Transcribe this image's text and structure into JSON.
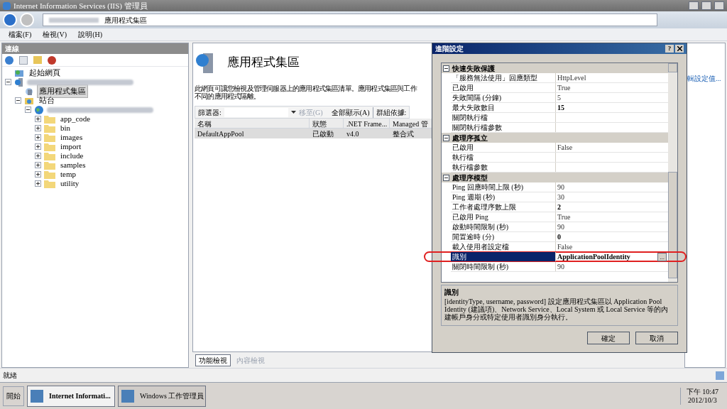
{
  "window": {
    "title": "Internet Information Services (IIS) 管理員"
  },
  "address_bar": {
    "crumbs": [
      {
        "kind": "redacted"
      },
      {
        "kind": "text",
        "label": "應用程式集區"
      }
    ]
  },
  "menu": [
    "檔案(F)",
    "檢視(V)",
    "說明(H)"
  ],
  "connections": {
    "title": "連線",
    "tree": [
      {
        "kind": "home",
        "label": "起始網頁",
        "selected": false
      },
      {
        "kind": "server",
        "expanded": true,
        "selected": false,
        "children": [
          {
            "kind": "pool",
            "label": "應用程式集區",
            "selected": true
          },
          {
            "kind": "sites",
            "label": "站台",
            "expanded": true,
            "selected": false,
            "children": [
              {
                "kind": "site",
                "expanded": true,
                "selected": false,
                "children": [
                  {
                    "kind": "folder",
                    "label": "app_code",
                    "expanded": false,
                    "selected": false
                  },
                  {
                    "kind": "folder",
                    "label": "bin",
                    "expanded": false,
                    "selected": false
                  },
                  {
                    "kind": "folder",
                    "label": "images",
                    "expanded": false,
                    "selected": false
                  },
                  {
                    "kind": "folder",
                    "label": "import",
                    "expanded": false,
                    "selected": false
                  },
                  {
                    "kind": "folder",
                    "label": "include",
                    "expanded": false,
                    "selected": false
                  },
                  {
                    "kind": "folder",
                    "label": "samples",
                    "expanded": false,
                    "selected": false
                  },
                  {
                    "kind": "folder",
                    "label": "temp",
                    "expanded": false,
                    "selected": false
                  },
                  {
                    "kind": "folder",
                    "label": "utility",
                    "expanded": false,
                    "selected": false
                  }
                ]
              }
            ]
          }
        ]
      }
    ]
  },
  "page": {
    "title": "應用程式集區",
    "description": [
      "此網頁可讓您檢視及管理伺服器上的應用程式集區清單。應用程式集區與工作",
      "不同的應用程式隔離。"
    ],
    "filter": {
      "label": "篩選器:",
      "go": "移至(G)",
      "show_all": "全部顯示(A)",
      "group_by": "群組依據:"
    },
    "table": {
      "columns": [
        "名稱",
        "狀態",
        ".NET Frame...",
        "Managed 管"
      ],
      "rows": [
        {
          "cells": [
            "DefaultAppPool",
            "已啟動",
            "v4.0",
            "整合式"
          ],
          "selected": true
        }
      ]
    },
    "view_tabs": [
      {
        "label": "功能檢視",
        "selected": true
      },
      {
        "label": "內容檢視",
        "selected": false
      }
    ]
  },
  "actions": {
    "link": "輯設定值..."
  },
  "dialog": {
    "title": "進階設定",
    "help": "?",
    "sections": [
      {
        "title": "快速失敗保護",
        "expanded": true,
        "rows": [
          {
            "name": "「服務無法使用」回應類型",
            "value": "HttpLevel",
            "bold": false,
            "selected": false
          },
          {
            "name": "已啟用",
            "value": "True",
            "bold": false,
            "selected": false
          },
          {
            "name": "失敗間隔 (分鐘)",
            "value": "5",
            "bold": false,
            "selected": false
          },
          {
            "name": "最大失敗數目",
            "value": "15",
            "bold": true,
            "selected": false
          },
          {
            "name": "關閉執行檔",
            "selected": false
          },
          {
            "name": "關閉執行檔參數",
            "selected": false
          }
        ]
      },
      {
        "title": "處理序孤立",
        "expanded": true,
        "rows": [
          {
            "name": "已啟用",
            "value": "False",
            "bold": false,
            "selected": false
          },
          {
            "name": "執行檔",
            "selected": false
          },
          {
            "name": "執行檔參數",
            "selected": false
          }
        ]
      },
      {
        "title": "處理序模型",
        "expanded": true,
        "rows": [
          {
            "name": "Ping 回應時間上限 (秒)",
            "value": "90",
            "bold": false,
            "selected": false
          },
          {
            "name": "Ping 週期 (秒)",
            "value": "30",
            "bold": false,
            "selected": false
          },
          {
            "name": "工作者處理序數上限",
            "value": "2",
            "bold": true,
            "selected": false
          },
          {
            "name": "已啟用 Ping",
            "value": "True",
            "bold": false,
            "selected": false
          },
          {
            "name": "啟動時間限制 (秒)",
            "value": "90",
            "bold": false,
            "selected": false
          },
          {
            "name": "閒置逾時 (分)",
            "value": "0",
            "bold": true,
            "selected": false
          },
          {
            "name": "載入使用者設定檔",
            "value": "False",
            "bold": false,
            "selected": false
          },
          {
            "name": "識別",
            "value": "ApplicationPoolIdentity",
            "bold": true,
            "selected": true,
            "ellipsis": "..."
          },
          {
            "name": "關閉時間限制 (秒)",
            "value": "90",
            "bold": false,
            "selected": false
          }
        ]
      }
    ],
    "description": {
      "title": "識別",
      "text": "[identityType, username, password] 設定應用程式集區以 Application Pool Identity (建議項)、Network Service、Local System 或 Local Service 等的內建帳戶身分或特定使用者識別身分執行。"
    },
    "buttons": [
      "確定",
      "取消"
    ]
  },
  "status_bar": {
    "text": "就緒"
  },
  "taskbar": {
    "start": "開始",
    "tasks": [
      {
        "label": "Internet Informati...",
        "selected": true
      },
      {
        "label": "Windows 工作管理員",
        "selected": false
      }
    ],
    "time": "下午 10:47",
    "date": "2012/10/3"
  }
}
